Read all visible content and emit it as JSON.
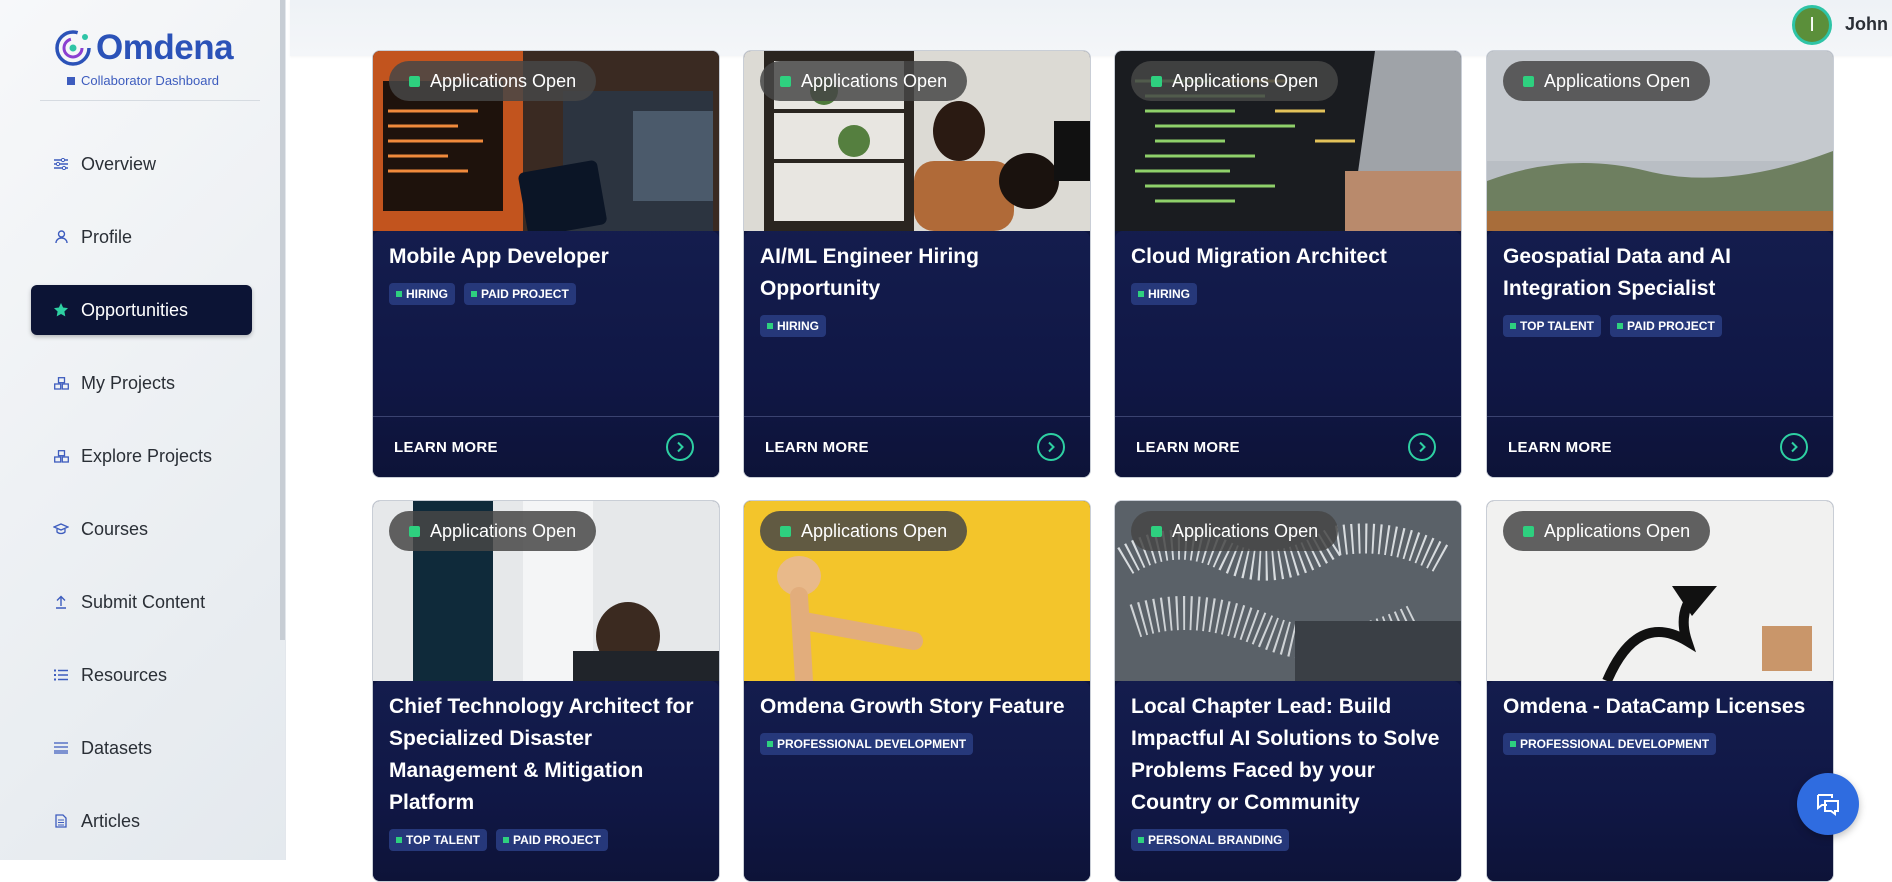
{
  "brand": {
    "name": "Omdena",
    "subtitle": "Collaborator Dashboard"
  },
  "user": {
    "initial": "I",
    "name": "John"
  },
  "nav": [
    {
      "label": "Overview",
      "icon": "sliders-icon"
    },
    {
      "label": "Profile",
      "icon": "user-icon"
    },
    {
      "label": "Opportunities",
      "icon": "star-icon",
      "active": true
    },
    {
      "label": "My Projects",
      "icon": "cubes-icon"
    },
    {
      "label": "Explore Projects",
      "icon": "cubes-icon"
    },
    {
      "label": "Courses",
      "icon": "graduation-cap-icon"
    },
    {
      "label": "Submit Content",
      "icon": "upload-icon"
    },
    {
      "label": "Resources",
      "icon": "list-icon"
    },
    {
      "label": "Datasets",
      "icon": "table-icon"
    },
    {
      "label": "Articles",
      "icon": "document-icon"
    }
  ],
  "cards": [
    {
      "status": "Applications Open",
      "title": "Mobile App Developer",
      "tags": [
        "HIRING",
        "PAID PROJECT"
      ],
      "cta": "LEARN MORE",
      "image": "developer-laptop-photo"
    },
    {
      "status": "Applications Open",
      "title": "AI/ML Engineer Hiring Opportunity",
      "tags": [
        "HIRING"
      ],
      "cta": "LEARN MORE",
      "image": "team-office-photo"
    },
    {
      "status": "Applications Open",
      "title": "Cloud Migration Architect",
      "tags": [
        "HIRING"
      ],
      "cta": "LEARN MORE",
      "image": "code-screen-photo"
    },
    {
      "status": "Applications Open",
      "title": "Geospatial Data and AI Integration Specialist",
      "tags": [
        "TOP TALENT",
        "PAID PROJECT"
      ],
      "cta": "LEARN MORE",
      "image": "landscape-photo"
    },
    {
      "status": "Applications Open",
      "title": "Chief Technology Architect for Specialized Disaster Management & Mitigation Platform",
      "tags": [
        "TOP TALENT",
        "PAID PROJECT"
      ],
      "image": "man-window-photo"
    },
    {
      "status": "Applications Open",
      "title": "Omdena Growth Story Feature",
      "tags": [
        "PROFESSIONAL DEVELOPMENT"
      ],
      "image": "wooden-mannequin-photo"
    },
    {
      "status": "Applications Open",
      "title": "Local Chapter Lead: Build Impactful AI Solutions to Solve Problems Faced by your Country or Community",
      "tags": [
        "PERSONAL BRANDING"
      ],
      "image": "world-map-photo"
    },
    {
      "status": "Applications Open",
      "title": "Omdena - DataCamp Licenses",
      "tags": [
        "PROFESSIONAL DEVELOPMENT"
      ],
      "image": "arrow-blocks-photo"
    }
  ],
  "chat_button": {
    "icon": "chat-icon"
  }
}
